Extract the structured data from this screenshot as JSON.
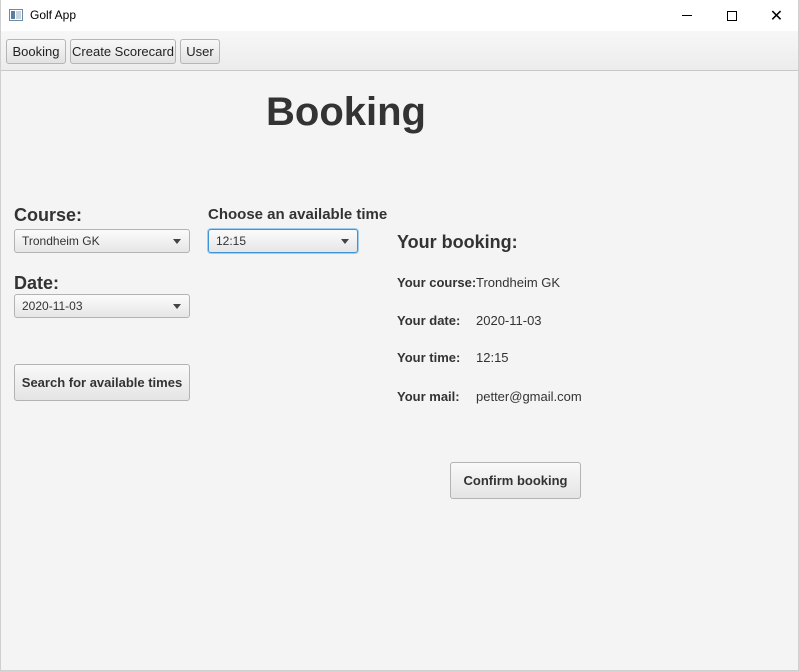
{
  "window": {
    "title": "Golf App",
    "minimize_label": "—",
    "maximize_label": "□",
    "close_label": "✕"
  },
  "toolbar": {
    "booking_label": "Booking",
    "create_scorecard_label": "Create Scorecard",
    "user_label": "User"
  },
  "page": {
    "title": "Booking"
  },
  "form": {
    "course_label": "Course:",
    "course_value": "Trondheim GK",
    "date_label": "Date:",
    "date_value": "2020-11-03",
    "search_button_label": "Search for available times",
    "time_label": "Choose an available time",
    "time_value": "12:15"
  },
  "summary": {
    "heading": "Your booking:",
    "course_label": "Your course:",
    "course_value": "Trondheim GK",
    "date_label": "Your date:",
    "date_value": "2020-11-03",
    "time_label": "Your time:",
    "time_value": "12:15",
    "mail_label": "Your mail:",
    "mail_value": "petter@gmail.com",
    "confirm_button_label": "Confirm booking"
  },
  "colors": {
    "background": "#f4f4f4",
    "focus_accent": "#3d94d6",
    "text": "#333333"
  }
}
